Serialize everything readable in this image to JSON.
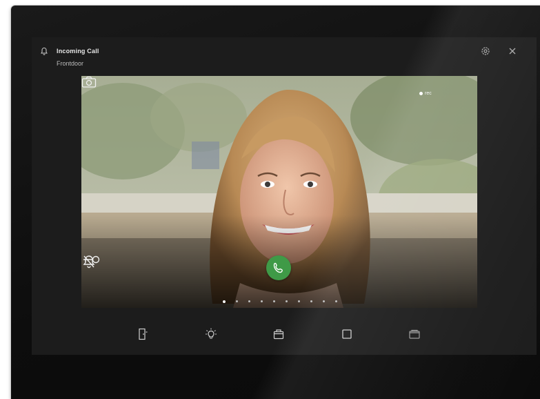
{
  "call": {
    "title": "Incoming Call",
    "subtitle": "Frontdoor"
  },
  "video": {
    "live_label": "rec"
  },
  "icons": {
    "bell": "bell-icon",
    "settings": "settings-icon",
    "close": "close-icon",
    "camera": "camera-icon",
    "mute": "bell-off-icon",
    "answer": "phone-icon",
    "key": "key-icon"
  },
  "controls": {
    "answer_color": "#3f9a47"
  },
  "pager": {
    "count": 10,
    "active_index": 0
  },
  "toolbar": {
    "items": [
      {
        "name": "door-icon"
      },
      {
        "name": "light-icon"
      },
      {
        "name": "mailbox-icon"
      },
      {
        "name": "square-icon"
      },
      {
        "name": "folder-icon"
      }
    ]
  }
}
